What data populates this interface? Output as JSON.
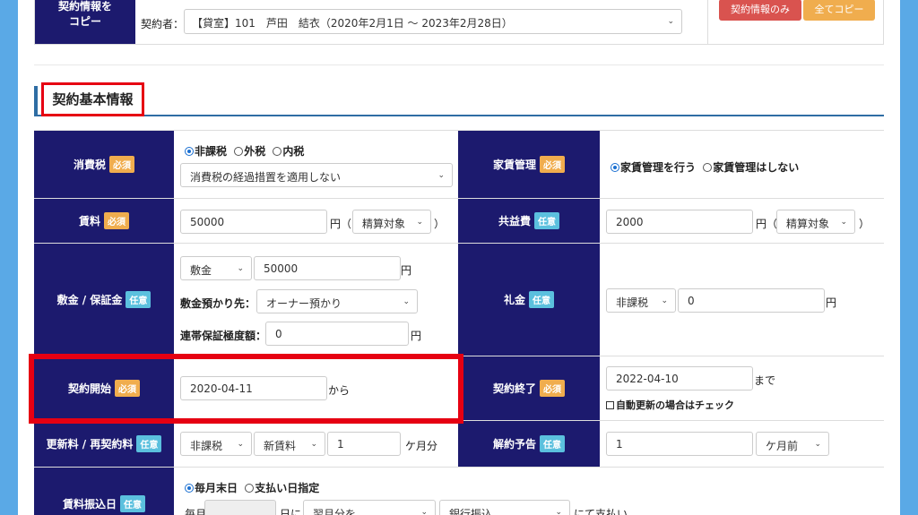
{
  "copy": {
    "label": "契約情報を\nコピー",
    "contractor_label": "契約者：",
    "contractor_value": "【貸室】101　芦田　結衣（2020年2月1日 ～ 2023年2月28日）",
    "btn_contract_only": "契約情報のみ",
    "btn_copy_all": "全てコピー"
  },
  "section_title": "契約基本情報",
  "badges": {
    "required": "必須",
    "optional": "任意"
  },
  "tax": {
    "label": "消費税",
    "radio_options": [
      "非課税",
      "外税",
      "内税"
    ],
    "selected": "非課税",
    "measure_select": "消費税の経過措置を適用しない"
  },
  "rent_mgmt": {
    "label": "家賃管理",
    "radio_options": [
      "家賃管理を行う",
      "家賃管理はしない"
    ],
    "selected": "家賃管理を行う"
  },
  "rent": {
    "label": "賃料",
    "value": "50000",
    "unit": "円（",
    "settle": "精算対象",
    "close": "）"
  },
  "common_fee": {
    "label": "共益費",
    "value": "2000",
    "unit": "円（",
    "settle": "精算対象",
    "close": "）"
  },
  "deposit": {
    "label": "敷金 / 保証金",
    "type": "敷金",
    "value": "50000",
    "unit": "円",
    "holder_label": "敷金預かり先：",
    "holder_value": "オーナー預かり",
    "guarantee_label": "連帯保証極度額：",
    "guarantee_value": "0",
    "guarantee_unit": "円"
  },
  "key_money": {
    "label": "礼金",
    "tax": "非課税",
    "value": "0",
    "unit": "円"
  },
  "start": {
    "label": "契約開始",
    "value": "2020-04-11",
    "suffix": "から"
  },
  "end": {
    "label": "契約終了",
    "value": "2022-04-10",
    "suffix": "まで",
    "auto_renew": "自動更新の場合はチェック"
  },
  "renewal": {
    "label": "更新料 / 再契約料",
    "tax": "非課税",
    "basis": "新賃料",
    "value": "1",
    "unit": "ケ月分"
  },
  "notice": {
    "label": "解約予告",
    "value": "1",
    "unit": "ケ月前"
  },
  "transfer": {
    "label": "賃料振込日",
    "radio_options": [
      "毎月末日",
      "支払い日指定"
    ],
    "selected": "毎月末日",
    "monthly_prefix": "毎月",
    "day_suffix": "日に",
    "month_select": "翌月分を",
    "method_select": "銀行振込",
    "pay_suffix": "にて支払い"
  }
}
